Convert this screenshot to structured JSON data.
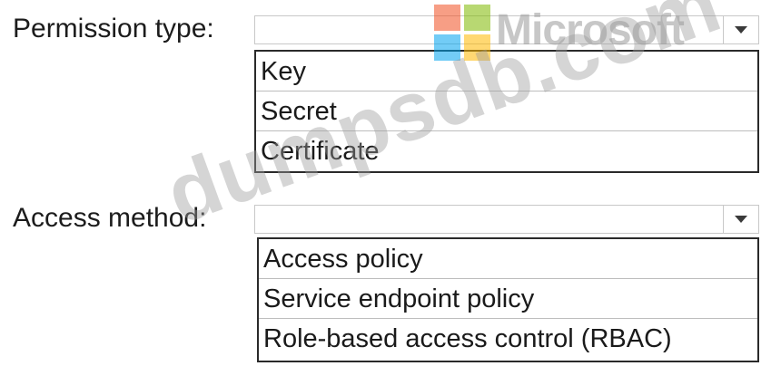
{
  "permission": {
    "label": "Permission type:",
    "options": [
      "Key",
      "Secret",
      "Certificate"
    ]
  },
  "access": {
    "label": "Access method:",
    "options": [
      "Access policy",
      "Service endpoint policy",
      "Role-based access control (RBAC)"
    ]
  },
  "brand": {
    "name": "Microsoft",
    "colors": [
      "#f25022",
      "#7fba00",
      "#00a4ef",
      "#ffb900"
    ]
  },
  "watermark": {
    "text": "dumpsdb.com"
  }
}
